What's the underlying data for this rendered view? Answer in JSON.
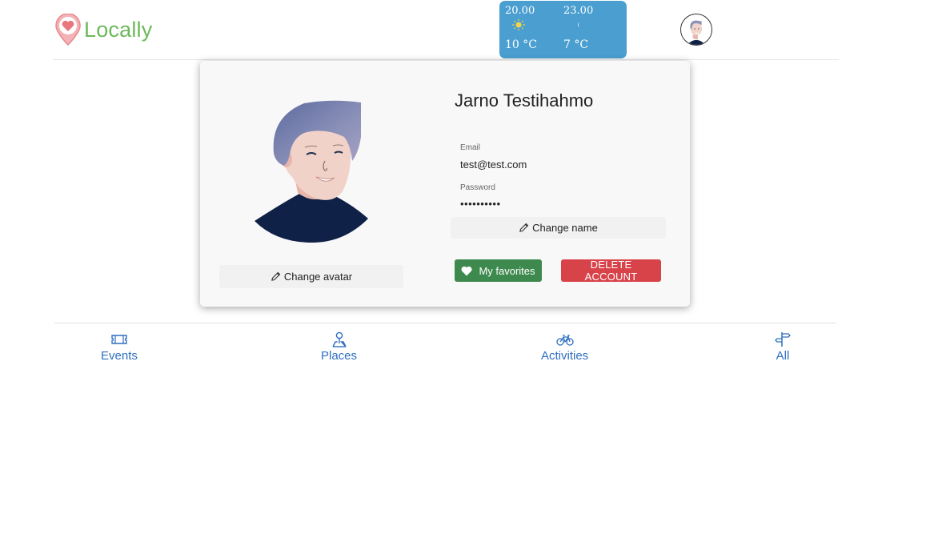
{
  "header": {
    "logo_text": "Locally",
    "brand_color": "#6cb85a",
    "logo_icon": "heart-pin-icon"
  },
  "weather": {
    "background": "#4a9fd0",
    "forecasts": [
      {
        "time": "20.00",
        "icon": "sun-icon",
        "temp": "10 °C"
      },
      {
        "time": "23.00",
        "icon": "moon-icon",
        "temp": "7 °C"
      }
    ]
  },
  "profile": {
    "name": "Jarno Testihahmo",
    "email_label": "Email",
    "email_value": "test@test.com",
    "password_label": "Password",
    "password_value": "••••••••••",
    "change_name_label": "Change name",
    "change_avatar_label": "Change avatar",
    "favorites_label": "My favorites",
    "delete_label": "DELETE ACCOUNT",
    "favorites_color": "#3e8a4e",
    "delete_color": "#d8434a"
  },
  "nav": {
    "items": [
      {
        "label": "Events",
        "icon": "ticket-icon"
      },
      {
        "label": "Places",
        "icon": "map-pin-person-icon"
      },
      {
        "label": "Activities",
        "icon": "bicycle-icon"
      },
      {
        "label": "All",
        "icon": "signpost-icon"
      }
    ],
    "color": "#2f6fc0"
  }
}
